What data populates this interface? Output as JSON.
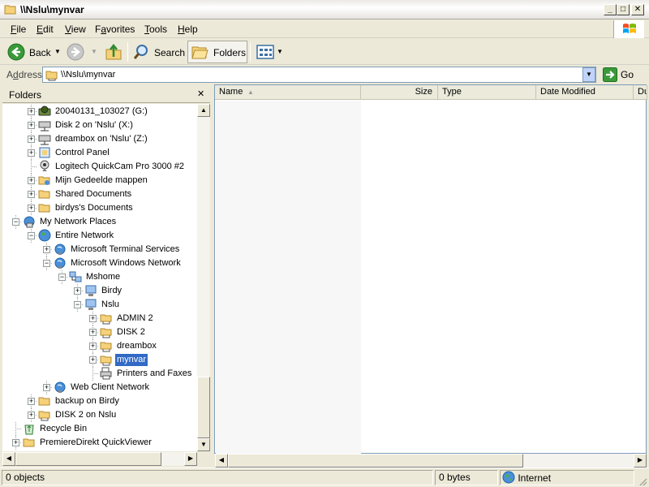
{
  "window": {
    "title": "\\\\Nslu\\mynvar"
  },
  "menu": [
    {
      "mnemonic": "F",
      "rest": "ile"
    },
    {
      "mnemonic": "E",
      "rest": "dit"
    },
    {
      "mnemonic": "V",
      "rest": "iew"
    },
    {
      "pre": "F",
      "mnemonic": "a",
      "rest": "vorites"
    },
    {
      "mnemonic": "T",
      "rest": "ools"
    },
    {
      "mnemonic": "H",
      "rest": "elp"
    }
  ],
  "toolbar": {
    "back_label": "Back",
    "search_label": "Search",
    "folders_label": "Folders"
  },
  "address": {
    "label": "Address",
    "label_mnemonic": "d",
    "value": "\\\\Nslu\\mynvar",
    "go_label": "Go"
  },
  "folders_pane": {
    "title": "Folders",
    "close_glyph": "✕"
  },
  "tree": [
    {
      "label": "20040131_103027 (G:)",
      "icon": "drive-icon"
    },
    {
      "label": "Disk 2 on 'Nslu' (X:)",
      "icon": "network-drive-icon"
    },
    {
      "label": "dreambox on 'Nslu' (Z:)",
      "icon": "network-drive-icon"
    },
    {
      "label": "Control Panel",
      "icon": "control-panel-icon"
    },
    {
      "label": "Logitech QuickCam Pro 3000 #2",
      "icon": "webcam-icon"
    },
    {
      "label": "Mijn Gedeelde mappen",
      "icon": "shared-folder-icon"
    },
    {
      "label": "Shared Documents",
      "icon": "folder-icon"
    },
    {
      "label": "birdys's Documents",
      "icon": "folder-icon"
    },
    {
      "label": "My Network Places",
      "icon": "network-places-icon"
    },
    {
      "label": "Entire Network",
      "icon": "globe-icon"
    },
    {
      "label": "Microsoft Terminal Services",
      "icon": "network-globe-icon"
    },
    {
      "label": "Microsoft Windows Network",
      "icon": "network-globe-icon"
    },
    {
      "label": "Mshome",
      "icon": "workgroup-icon"
    },
    {
      "label": "Birdy",
      "icon": "computer-icon"
    },
    {
      "label": "Nslu",
      "icon": "computer-icon"
    },
    {
      "label": "ADMIN 2",
      "icon": "network-share-icon"
    },
    {
      "label": "DISK 2",
      "icon": "network-share-icon"
    },
    {
      "label": "dreambox",
      "icon": "network-share-icon"
    },
    {
      "label": "mynvar",
      "icon": "network-share-icon"
    },
    {
      "label": "Printers and Faxes",
      "icon": "printer-icon"
    },
    {
      "label": "Web Client Network",
      "icon": "network-globe-icon"
    },
    {
      "label": "backup on Birdy",
      "icon": "folder-icon"
    },
    {
      "label": "DISK 2 on Nslu",
      "icon": "network-share-icon"
    },
    {
      "label": "Recycle Bin",
      "icon": "recycle-bin-icon"
    },
    {
      "label": "PremiereDirekt QuickViewer",
      "icon": "folder-icon"
    }
  ],
  "columns": [
    "Name",
    "Size",
    "Type",
    "Date Modified",
    "Du"
  ],
  "status": {
    "objects": "0 objects",
    "size": "0 bytes",
    "zone": "Internet"
  },
  "colors": {
    "selection": "#316ac5",
    "window_bg": "#ece9d8"
  }
}
